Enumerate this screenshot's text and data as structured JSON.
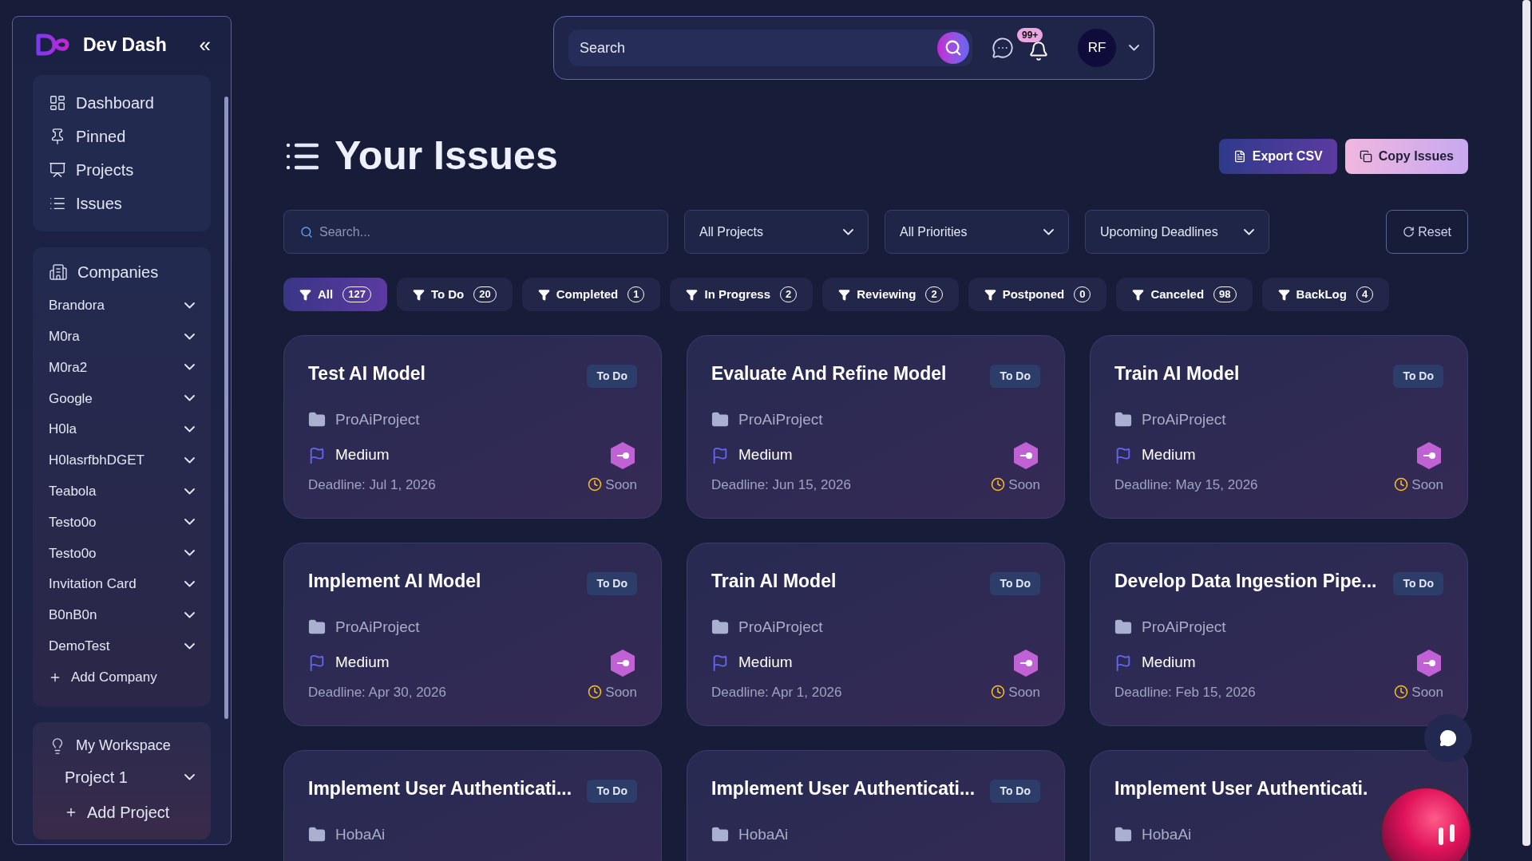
{
  "sidebar": {
    "app_name": "Dev Dash",
    "collapse_icon": "«",
    "nav": [
      {
        "label": "Dashboard",
        "kind": "dashboard",
        "selected": false
      },
      {
        "label": "Pinned",
        "kind": "pin",
        "selected": false
      },
      {
        "label": "Projects",
        "kind": "projects",
        "selected": false
      },
      {
        "label": "Issues",
        "kind": "issues",
        "selected": false
      }
    ],
    "companies": {
      "title": "Companies",
      "items": [
        {
          "label": "Brandora",
          "expanded": false
        },
        {
          "label": "M0ra",
          "expanded": false
        },
        {
          "label": "M0ra2",
          "expanded": false
        },
        {
          "label": "Google",
          "expanded": false
        },
        {
          "label": "H0la",
          "expanded": false
        },
        {
          "label": "H0lasrfbhDGET",
          "expanded": false
        },
        {
          "label": "Teabola",
          "expanded": false
        },
        {
          "label": "Testo0o",
          "expanded": false
        },
        {
          "label": "Testo0o",
          "expanded": false
        },
        {
          "label": "Invitation Card",
          "expanded": false
        },
        {
          "label": "B0nB0n",
          "expanded": false
        },
        {
          "label": "DemoTest",
          "expanded": false
        }
      ],
      "add": "Add Company"
    },
    "workspace": {
      "title": "My Workspace",
      "projects": [
        {
          "label": "Project 1",
          "expanded": false
        }
      ],
      "add": "Add Project"
    }
  },
  "topbar": {
    "search": {
      "placeholder": "Search"
    },
    "notifications": "99+",
    "avatar": "RF"
  },
  "page": {
    "title": "Your Issues",
    "buttons": [
      {
        "label": "Export CSV",
        "kind": "export"
      },
      {
        "label": "Copy Issues",
        "kind": "copy"
      }
    ]
  },
  "filters": {
    "search": {
      "placeholder": "Search..."
    },
    "dropdowns": [
      {
        "value": "All Projects"
      },
      {
        "value": "All Priorities"
      },
      {
        "value": "Upcoming Deadlines"
      }
    ],
    "reset": "Reset"
  },
  "tabs": [
    {
      "label": "All",
      "count": "127",
      "selected": true
    },
    {
      "label": "To Do",
      "count": "20",
      "selected": false
    },
    {
      "label": "Completed",
      "count": "1",
      "selected": false
    },
    {
      "label": "In Progress",
      "count": "2",
      "selected": false
    },
    {
      "label": "Reviewing",
      "count": "2",
      "selected": false
    },
    {
      "label": "Postponed",
      "count": "0",
      "selected": false
    },
    {
      "label": "Canceled",
      "count": "98",
      "selected": false
    },
    {
      "label": "BackLog",
      "count": "4",
      "selected": false
    }
  ],
  "issues": [
    {
      "title": "Test AI Model",
      "status": "To Do",
      "project": "ProAiProject",
      "priority": "Medium",
      "deadline": "Deadline: Jul 1, 2026",
      "due": "Soon"
    },
    {
      "title": "Evaluate And Refine Model",
      "status": "To Do",
      "project": "ProAiProject",
      "priority": "Medium",
      "deadline": "Deadline: Jun 15, 2026",
      "due": "Soon"
    },
    {
      "title": "Train AI Model",
      "status": "To Do",
      "project": "ProAiProject",
      "priority": "Medium",
      "deadline": "Deadline: May 15, 2026",
      "due": "Soon"
    },
    {
      "title": "Implement AI Model",
      "status": "To Do",
      "project": "ProAiProject",
      "priority": "Medium",
      "deadline": "Deadline: Apr 30, 2026",
      "due": "Soon"
    },
    {
      "title": "Train AI Model",
      "status": "To Do",
      "project": "ProAiProject",
      "priority": "Medium",
      "deadline": "Deadline: Apr 1, 2026",
      "due": "Soon"
    },
    {
      "title": "Develop Data Ingestion Pipe...",
      "status": "To Do",
      "project": "ProAiProject",
      "priority": "Medium",
      "deadline": "Deadline: Feb 15, 2026",
      "due": "Soon"
    },
    {
      "title": "Implement User Authenticati...",
      "status": "To Do",
      "project": "HobaAi"
    },
    {
      "title": "Implement User Authenticati...",
      "status": "To Do",
      "project": "HobaAi"
    },
    {
      "title": "Implement User Authenticati.",
      "project": "HobaAi"
    }
  ]
}
